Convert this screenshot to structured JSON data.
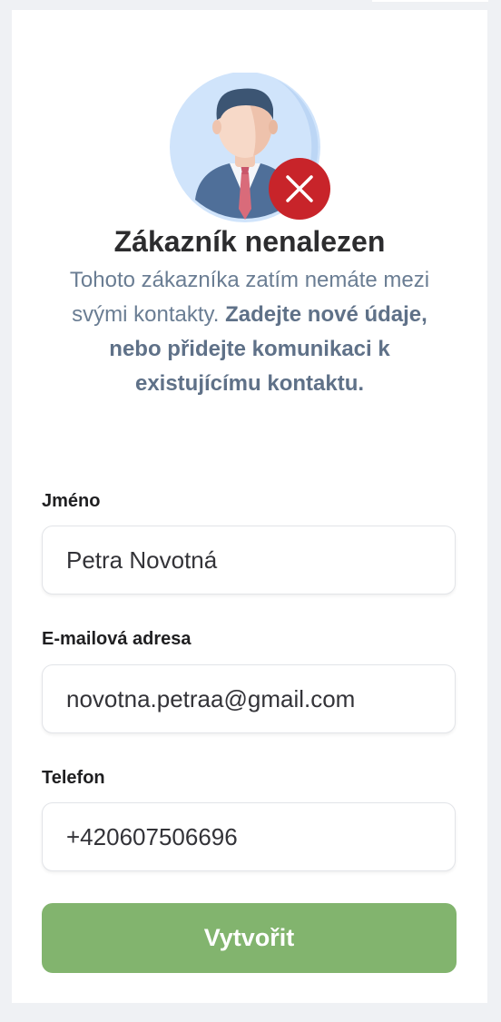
{
  "status": {
    "title": "Zákazník nenalezen",
    "description_plain": "Tohoto zákazníka zatím nemáte mezi svými kontakty.",
    "description_bold": "Zadejte nové údaje, nebo přidejte komunikaci k existujícímu kontaktu.",
    "avatar_icon": "customer-avatar-icon",
    "badge_icon": "error-x-icon",
    "badge_color": "#c8242a"
  },
  "form": {
    "name": {
      "label": "Jméno",
      "value": "Petra Novotná"
    },
    "email": {
      "label": "E-mailová adresa",
      "value": "novotna.petraa@gmail.com"
    },
    "phone": {
      "label": "Telefon",
      "value": "+420607506696"
    },
    "submit_label": "Vytvořit",
    "submit_color": "#82b46e"
  }
}
